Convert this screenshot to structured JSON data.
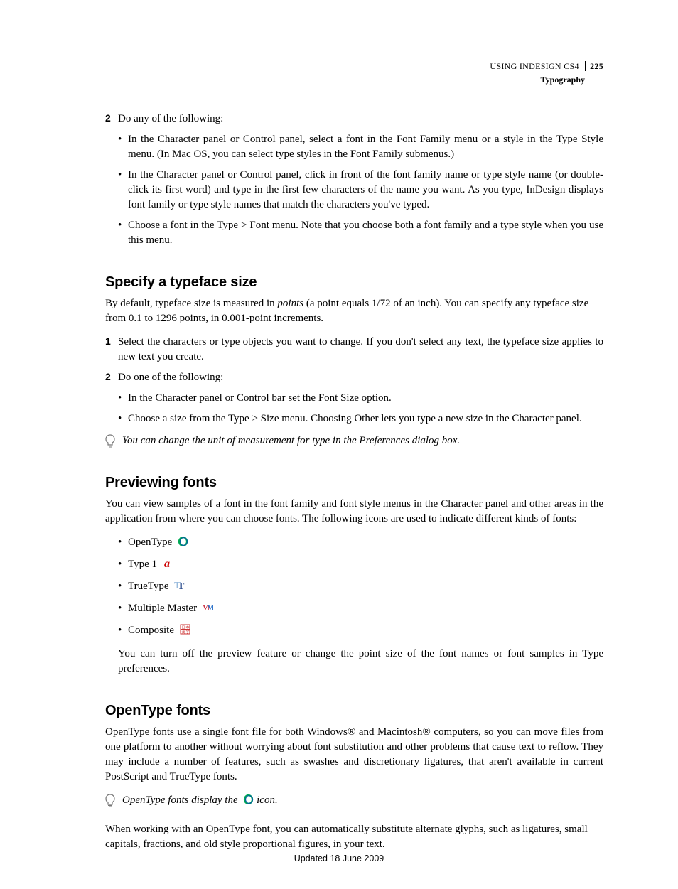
{
  "header": {
    "book": "USING INDESIGN CS4",
    "page": "225",
    "section": "Typography"
  },
  "intro_step": {
    "num": "2",
    "text": "Do any of the following:"
  },
  "intro_bullets": [
    "In the Character panel or Control panel, select a font in the Font Family menu or a style in the Type Style menu. (In Mac OS, you can select type styles in the Font Family submenus.)",
    "In the Character panel or Control panel, click in front of the font family name or type style name (or double-click its first word) and type in the first few characters of the name you want. As you type, InDesign displays font family or type style names that match the characters you've typed.",
    "Choose a font in the Type > Font menu. Note that you choose both a font family and a type style when you use this menu."
  ],
  "sec1": {
    "title": "Specify a typeface size",
    "p_before": "By default, typeface size is measured in ",
    "p_italic": "points",
    "p_after": " (a point equals 1/72 of an inch). You can specify any typeface size from 0.1 to 1296 points, in 0.001-point increments.",
    "step1": {
      "num": "1",
      "text": "Select the characters or type objects you want to change. If you don't select any text, the typeface size applies to new text you create."
    },
    "step2": {
      "num": "2",
      "text": "Do one of the following:"
    },
    "bullets": [
      "In the Character panel or Control bar set the Font Size option.",
      "Choose a size from the Type > Size menu. Choosing Other lets you type a new size in the Character panel."
    ],
    "tip": "You can change the unit of measurement for type in the Preferences dialog box."
  },
  "sec2": {
    "title": "Previewing fonts",
    "p": "You can view samples of a font in the font family and font style menus in the Character panel and other areas in the application from where you can choose fonts. The following icons are used to indicate different kinds of fonts:",
    "items": {
      "opentype": "OpenType",
      "type1": "Type 1",
      "truetype": "TrueType",
      "mm": "Multiple Master",
      "composite": "Composite"
    },
    "follow": "You can turn off the preview feature or change the point size of the font names or font samples in Type preferences."
  },
  "sec3": {
    "title": "OpenType fonts",
    "p": "OpenType fonts use a single font file for both Windows® and Macintosh® computers, so you can move files from one platform to another without worrying about font substitution and other problems that cause text to reflow. They may include a number of features, such as swashes and discretionary ligatures, that aren't available in current PostScript and TrueType fonts.",
    "tip_before": "OpenType fonts display the ",
    "tip_after": " icon.",
    "p2": "When working with an OpenType font, you can automatically substitute alternate glyphs, such as ligatures, small capitals, fractions, and old style proportional figures, in your text."
  },
  "footer": "Updated 18 June 2009"
}
